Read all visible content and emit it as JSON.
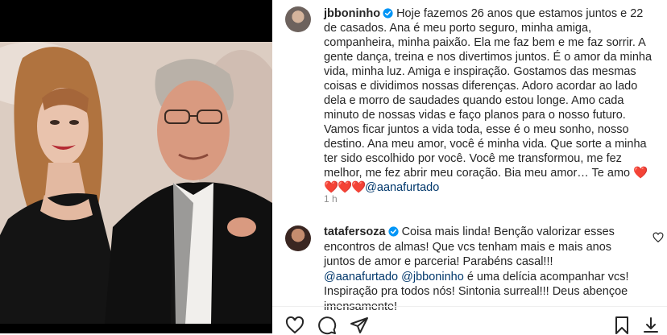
{
  "post": {
    "author": "jbboninho",
    "caption": "Hoje fazemos 26 anos que estamos juntos e 22 de casados. Ana é meu porto seguro, minha amiga, companheira, minha paixão. Ela me faz bem e me faz sorrir. A gente dança, treina e nos divertimos juntos. É o amor da minha vida, minha luz. Amiga e inspiração. Gostamos das mesmas coisas e dividimos nossas diferenças. Adoro acordar ao lado dela e morro de saudades quando estou longe. Amo cada minuto de nossas vidas e faço planos para o nosso futuro. Vamos ficar juntos a vida toda, esse é o meu sonho, nosso destino. Ana meu amor, você é minha vida. Que sorte a minha ter sido escolhido por você. Você me transformou, me fez melhor, me fez abrir meu coração. Bia meu amor… Te amo",
    "caption_hearts": "❤️❤️❤️❤️",
    "caption_mention": "@aanafurtado",
    "time_ago": "1 h"
  },
  "comment": {
    "author": "tatafersoza",
    "text_1": "Coisa mais linda! Benção valorizar esses encontros de almas! Que vcs tenham mais e mais anos juntos de amor e parceria! Parabéns casal!!!",
    "mention_1": "@aanafurtado",
    "mention_2": "@jbboninho",
    "text_2": "é uma delícia acompanhar vcs! Inspiração pra todos nós! Sintonia surreal!!! Deus abençoe imensamente!"
  },
  "icons": {
    "verified": "verified-badge-icon",
    "like": "heart-outline-icon",
    "comment": "comment-bubble-icon",
    "share": "paper-plane-icon",
    "save": "bookmark-icon"
  },
  "colors": {
    "verified": "#0095f6",
    "mention": "#00376b",
    "heart": "#ed4956",
    "muted": "#8e8e8e"
  }
}
